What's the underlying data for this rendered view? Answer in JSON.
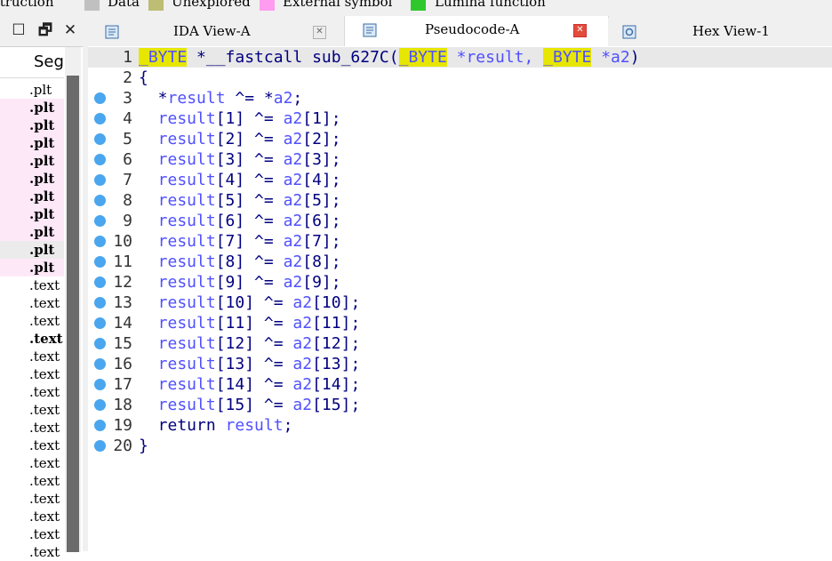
{
  "legend": {
    "items": [
      {
        "label": "struction",
        "swatch": ""
      },
      {
        "label": "Data",
        "swatch": "#c0c0c0"
      },
      {
        "label": "Unexplored",
        "swatch": "#bdbd74"
      },
      {
        "label": "External symbol",
        "swatch": "#ff9cf0"
      },
      {
        "label": "Lumina function",
        "swatch": "#2ec82e"
      }
    ]
  },
  "window_buttons": {
    "restore": "☐",
    "float": "🗗",
    "close": "✕"
  },
  "tabs": [
    {
      "label": "IDA View-A",
      "close": "✕",
      "icon": "ida-view-icon",
      "active": false
    },
    {
      "label": "Pseudocode-A",
      "close": "✕",
      "icon": "pseudocode-icon",
      "active": true
    },
    {
      "label": "Hex View-1",
      "close": "",
      "icon": "hex-view-icon",
      "active": false
    }
  ],
  "segments": {
    "header": "Seg",
    "rows": [
      {
        "text": ".plt",
        "style": "plain"
      },
      {
        "text": ".plt",
        "style": "ext"
      },
      {
        "text": ".plt",
        "style": "ext"
      },
      {
        "text": ".plt",
        "style": "ext"
      },
      {
        "text": ".plt",
        "style": "ext"
      },
      {
        "text": ".plt",
        "style": "ext"
      },
      {
        "text": ".plt",
        "style": "ext"
      },
      {
        "text": ".plt",
        "style": "ext"
      },
      {
        "text": ".plt",
        "style": "ext"
      },
      {
        "text": ".plt",
        "style": "sel"
      },
      {
        "text": ".plt",
        "style": "ext"
      },
      {
        "text": ".text",
        "style": "plain"
      },
      {
        "text": ".text",
        "style": "plain"
      },
      {
        "text": ".text",
        "style": "plain"
      },
      {
        "text": ".text",
        "style": "bold"
      },
      {
        "text": ".text",
        "style": "plain"
      },
      {
        "text": ".text",
        "style": "plain"
      },
      {
        "text": ".text",
        "style": "plain"
      },
      {
        "text": ".text",
        "style": "plain"
      },
      {
        "text": ".text",
        "style": "plain"
      },
      {
        "text": ".text",
        "style": "plain"
      },
      {
        "text": ".text",
        "style": "plain"
      },
      {
        "text": ".text",
        "style": "plain"
      },
      {
        "text": ".text",
        "style": "plain"
      },
      {
        "text": ".text",
        "style": "plain"
      },
      {
        "text": ".text",
        "style": "plain"
      },
      {
        "text": ".text",
        "style": "plain"
      }
    ]
  },
  "code": {
    "lines": [
      {
        "n": "1",
        "bp": false,
        "parts": [
          [
            "hl",
            "_BYTE"
          ],
          [
            "kw",
            " *__fastcall sub_627C("
          ],
          [
            "hl",
            "_BYTE"
          ],
          [
            "plain",
            " *result, "
          ],
          [
            "hl",
            "_BYTE"
          ],
          [
            "plain",
            " *a2"
          ],
          [
            "kw",
            ")"
          ]
        ]
      },
      {
        "n": "2",
        "bp": false,
        "parts": [
          [
            "kw",
            "{"
          ]
        ]
      },
      {
        "n": "3",
        "bp": true,
        "parts": [
          [
            "kw",
            "  *"
          ],
          [
            "var",
            "result"
          ],
          [
            "kw",
            " ^= *"
          ],
          [
            "var",
            "a2"
          ],
          [
            "kw",
            ";"
          ]
        ]
      },
      {
        "n": "4",
        "bp": true,
        "parts": [
          [
            "var",
            "  result"
          ],
          [
            "kw",
            "[1] ^= "
          ],
          [
            "var",
            "a2"
          ],
          [
            "kw",
            "[1];"
          ]
        ]
      },
      {
        "n": "5",
        "bp": true,
        "parts": [
          [
            "var",
            "  result"
          ],
          [
            "kw",
            "[2] ^= "
          ],
          [
            "var",
            "a2"
          ],
          [
            "kw",
            "[2];"
          ]
        ]
      },
      {
        "n": "6",
        "bp": true,
        "parts": [
          [
            "var",
            "  result"
          ],
          [
            "kw",
            "[3] ^= "
          ],
          [
            "var",
            "a2"
          ],
          [
            "kw",
            "[3];"
          ]
        ]
      },
      {
        "n": "7",
        "bp": true,
        "parts": [
          [
            "var",
            "  result"
          ],
          [
            "kw",
            "[4] ^= "
          ],
          [
            "var",
            "a2"
          ],
          [
            "kw",
            "[4];"
          ]
        ]
      },
      {
        "n": "8",
        "bp": true,
        "parts": [
          [
            "var",
            "  result"
          ],
          [
            "kw",
            "[5] ^= "
          ],
          [
            "var",
            "a2"
          ],
          [
            "kw",
            "[5];"
          ]
        ]
      },
      {
        "n": "9",
        "bp": true,
        "parts": [
          [
            "var",
            "  result"
          ],
          [
            "kw",
            "[6] ^= "
          ],
          [
            "var",
            "a2"
          ],
          [
            "kw",
            "[6];"
          ]
        ]
      },
      {
        "n": "10",
        "bp": true,
        "parts": [
          [
            "var",
            "  result"
          ],
          [
            "kw",
            "[7] ^= "
          ],
          [
            "var",
            "a2"
          ],
          [
            "kw",
            "[7];"
          ]
        ]
      },
      {
        "n": "11",
        "bp": true,
        "parts": [
          [
            "var",
            "  result"
          ],
          [
            "kw",
            "[8] ^= "
          ],
          [
            "var",
            "a2"
          ],
          [
            "kw",
            "[8];"
          ]
        ]
      },
      {
        "n": "12",
        "bp": true,
        "parts": [
          [
            "var",
            "  result"
          ],
          [
            "kw",
            "[9] ^= "
          ],
          [
            "var",
            "a2"
          ],
          [
            "kw",
            "[9];"
          ]
        ]
      },
      {
        "n": "13",
        "bp": true,
        "parts": [
          [
            "var",
            "  result"
          ],
          [
            "kw",
            "[10] ^= "
          ],
          [
            "var",
            "a2"
          ],
          [
            "kw",
            "[10];"
          ]
        ]
      },
      {
        "n": "14",
        "bp": true,
        "parts": [
          [
            "var",
            "  result"
          ],
          [
            "kw",
            "[11] ^= "
          ],
          [
            "var",
            "a2"
          ],
          [
            "kw",
            "[11];"
          ]
        ]
      },
      {
        "n": "15",
        "bp": true,
        "parts": [
          [
            "var",
            "  result"
          ],
          [
            "kw",
            "[12] ^= "
          ],
          [
            "var",
            "a2"
          ],
          [
            "kw",
            "[12];"
          ]
        ]
      },
      {
        "n": "16",
        "bp": true,
        "parts": [
          [
            "var",
            "  result"
          ],
          [
            "kw",
            "[13] ^= "
          ],
          [
            "var",
            "a2"
          ],
          [
            "kw",
            "[13];"
          ]
        ]
      },
      {
        "n": "17",
        "bp": true,
        "parts": [
          [
            "var",
            "  result"
          ],
          [
            "kw",
            "[14] ^= "
          ],
          [
            "var",
            "a2"
          ],
          [
            "kw",
            "[14];"
          ]
        ]
      },
      {
        "n": "18",
        "bp": true,
        "parts": [
          [
            "var",
            "  result"
          ],
          [
            "kw",
            "[15] ^= "
          ],
          [
            "var",
            "a2"
          ],
          [
            "kw",
            "[15];"
          ]
        ]
      },
      {
        "n": "19",
        "bp": true,
        "parts": [
          [
            "kw",
            "  return "
          ],
          [
            "var",
            "result"
          ],
          [
            "kw",
            ";"
          ]
        ]
      },
      {
        "n": "20",
        "bp": true,
        "parts": [
          [
            "kw",
            "}"
          ]
        ]
      }
    ]
  }
}
